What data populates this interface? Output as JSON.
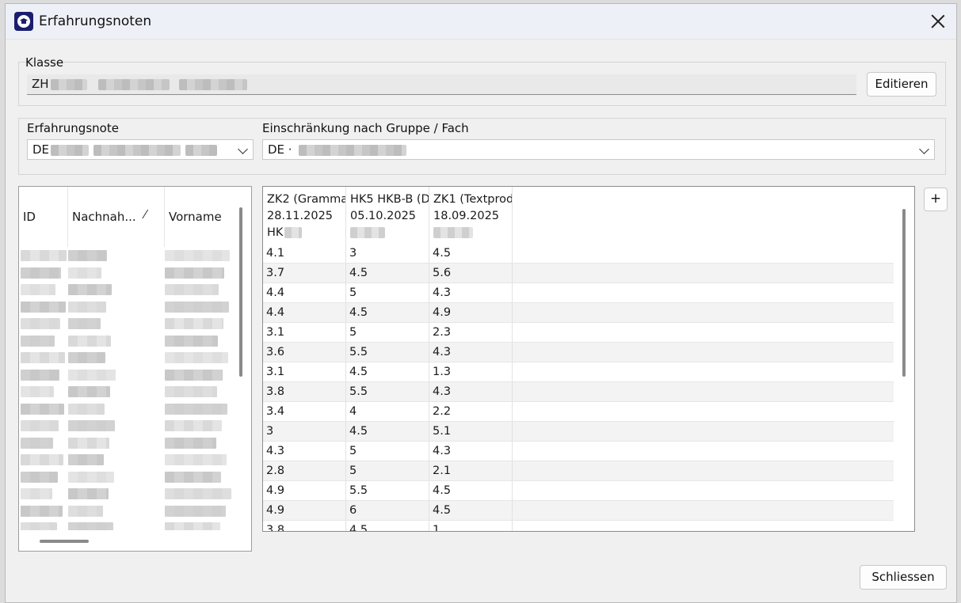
{
  "window": {
    "title": "Erfahrungsnoten"
  },
  "klasse": {
    "label": "Klasse",
    "value_prefix": "ZH",
    "edit_label": "Editieren"
  },
  "erfahrungsnote": {
    "label": "Erfahrungsnote",
    "value_prefix": "DE"
  },
  "filter": {
    "label": "Einschränkung nach Gruppe / Fach",
    "value_prefix": "DE ·"
  },
  "students": {
    "columns": [
      "ID",
      "Nachnah...",
      "Vorname"
    ],
    "sort_indicator": "⁄"
  },
  "grades": {
    "columns": [
      {
        "name": "ZK2 (Gramma",
        "date": "28.11.2025",
        "group": "HK"
      },
      {
        "name": "HK5 HKB-B (D",
        "date": "05.10.2025",
        "group": ""
      },
      {
        "name": "ZK1 (Textprod",
        "date": "18.09.2025",
        "group": ""
      }
    ],
    "rows": [
      [
        "4.1",
        "3",
        "4.5"
      ],
      [
        "3.7",
        "4.5",
        "5.6"
      ],
      [
        "4.4",
        "5",
        "4.3"
      ],
      [
        "4.4",
        "4.5",
        "4.9"
      ],
      [
        "3.1",
        "5",
        "2.3"
      ],
      [
        "3.6",
        "5.5",
        "4.3"
      ],
      [
        "3.1",
        "4.5",
        "1.3"
      ],
      [
        "3.8",
        "5.5",
        "4.3"
      ],
      [
        "3.4",
        "4",
        "2.2"
      ],
      [
        "3",
        "4.5",
        "5.1"
      ],
      [
        "4.3",
        "5",
        "4.3"
      ],
      [
        "2.8",
        "5",
        "2.1"
      ],
      [
        "4.9",
        "5.5",
        "4.5"
      ],
      [
        "4.9",
        "6",
        "4.5"
      ],
      [
        "3.8",
        "4.5",
        "1"
      ]
    ],
    "add_label": "+"
  },
  "footer": {
    "close_label": "Schliessen"
  }
}
